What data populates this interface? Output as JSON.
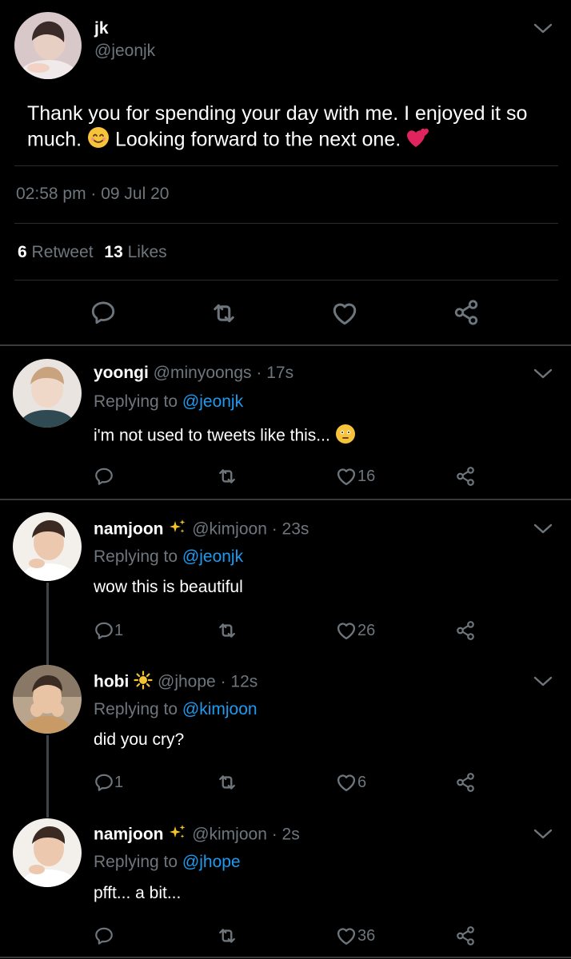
{
  "main_tweet": {
    "display_name": "jk",
    "handle": "@jeonjk",
    "text_part1": "Thank you for spending your day with me. I enjoyed it so much.",
    "text_part2": "Looking forward to the next one.",
    "time": "02:58 pm · 09 Jul 20",
    "retweet_count": "6",
    "retweet_label": "Retweet",
    "like_count": "13",
    "like_label": "Likes"
  },
  "replies": [
    {
      "display_name": "yoongi",
      "handle": "@minyoongs",
      "age": "· 17s",
      "replying_label": "Replying to",
      "replying_to": "@jeonjk",
      "text": "i'm not used to tweets like this...",
      "reply_count": "",
      "like_count": "16"
    },
    {
      "display_name": "namjoon",
      "handle": "@kimjoon",
      "age": "· 23s",
      "replying_label": "Replying to",
      "replying_to": "@jeonjk",
      "text": "wow this is beautiful",
      "reply_count": "1",
      "like_count": "26"
    },
    {
      "display_name": "hobi",
      "handle": "@jhope",
      "age": "· 12s",
      "replying_label": "Replying to",
      "replying_to": "@kimjoon",
      "text": "did you cry?",
      "reply_count": "1",
      "like_count": "6"
    },
    {
      "display_name": "namjoon",
      "handle": "@kimjoon",
      "age": "· 2s",
      "replying_label": "Replying to",
      "replying_to": "@jhope",
      "text": "pfft... a bit...",
      "reply_count": "",
      "like_count": "36"
    }
  ],
  "icons": {
    "reply": "reply-icon",
    "retweet": "retweet-icon",
    "like": "heart-icon",
    "share": "share-icon",
    "menu": "chevron-down-icon",
    "sparkles": "sparkles-icon",
    "sun": "sun-icon"
  },
  "colors": {
    "background": "#000000",
    "link": "#1d9bf0",
    "muted": "#6e767d",
    "text": "#d9d9d9"
  }
}
